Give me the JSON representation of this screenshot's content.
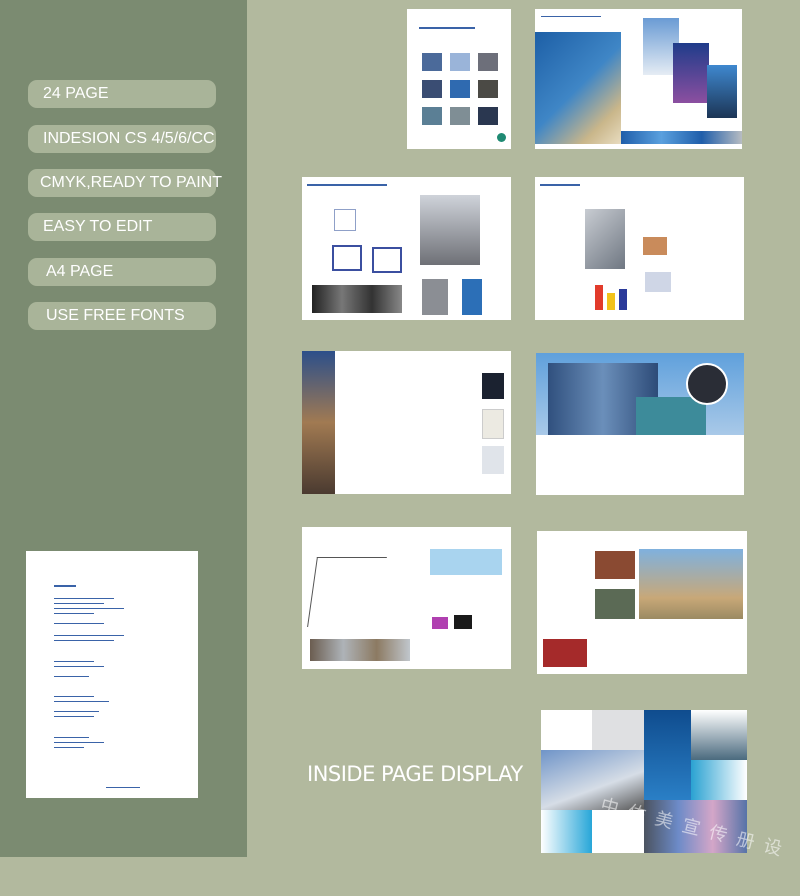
{
  "features": [
    "24 PAGE",
    "INDESION CS 4/5/6/CC",
    "CMYK,READY TO PAINT",
    "EASY TO EDIT",
    "A4 PAGE",
    "USE FREE FONTS"
  ],
  "section_title": "INSIDE PAGE DISPLAY",
  "watermark": "中佑美宣传册设计",
  "colors": {
    "left_panel": "#7b8b71",
    "background": "#b2b99e",
    "pill": "#a9b499",
    "accent_blue": "#1e5ea8"
  }
}
